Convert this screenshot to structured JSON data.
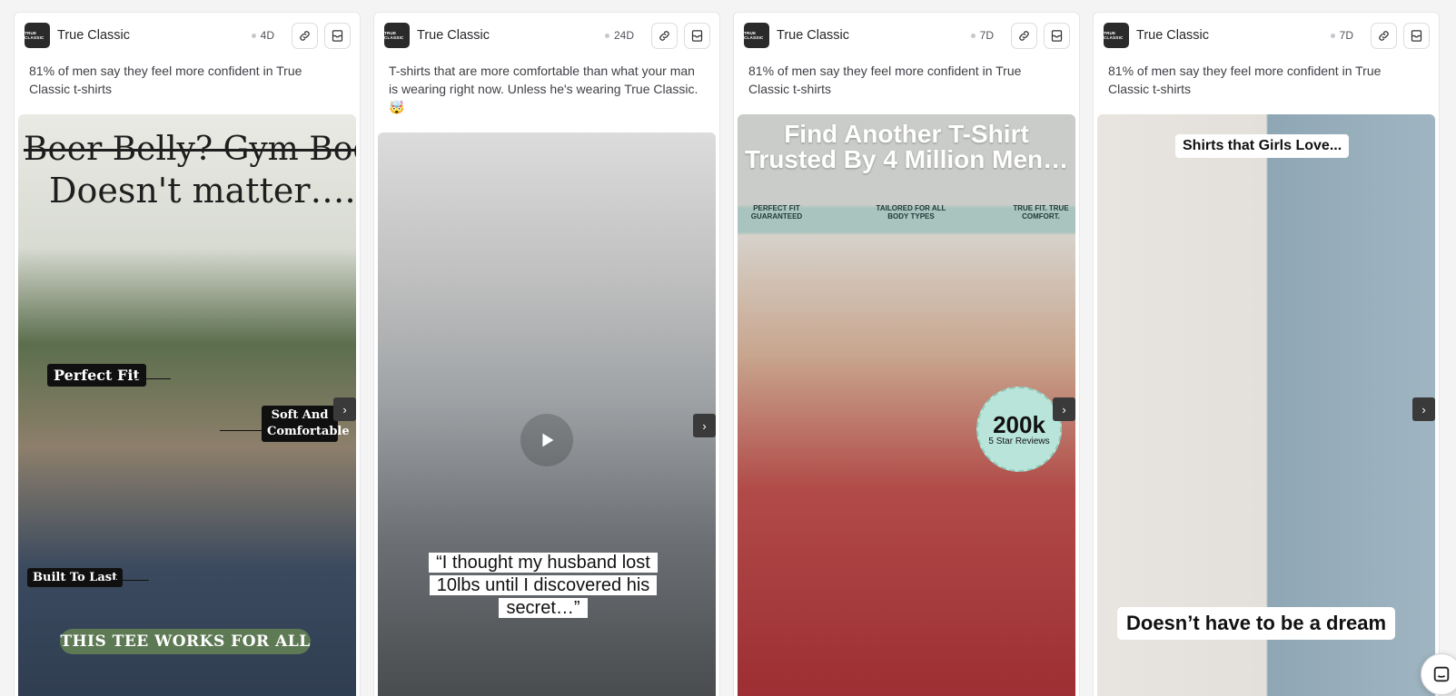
{
  "cards": [
    {
      "brand": "True Classic",
      "logo_text": "TRUE CLASSIC",
      "age": "4D",
      "caption": "81% of men say they feel more confident in True Classic t-shirts",
      "media": {
        "headline_struck": "Beer Belly? Gym Bod?",
        "headline": "Doesn't matter….",
        "tag_fit": "Perfect Fit",
        "tag_soft": "Soft And Comfortable",
        "tag_last": "Built To Last",
        "banner": "THIS TEE WORKS FOR ALL"
      }
    },
    {
      "brand": "True Classic",
      "logo_text": "TRUE CLASSIC",
      "age": "24D",
      "caption": "T-shirts that are more comfortable than what your man is wearing right now. Unless he's wearing True Classic. 🤯",
      "media": {
        "quote": "“I thought my husband lost 10lbs until I discovered his secret…”"
      }
    },
    {
      "brand": "True Classic",
      "logo_text": "TRUE CLASSIC",
      "age": "7D",
      "caption": "81% of men say they feel more confident in True Classic t-shirts",
      "media": {
        "headline": "Find Another T-Shirt Trusted By 4 Million Men…",
        "strip_1": "PERFECT FIT GUARANTEED",
        "strip_2": "TAILORED FOR ALL BODY TYPES",
        "strip_3": "TRUE FIT. TRUE COMFORT.",
        "badge_value": "200k",
        "badge_label": "5 Star Reviews"
      }
    },
    {
      "brand": "True Classic",
      "logo_text": "TRUE CLASSIC",
      "age": "7D",
      "caption": "81% of men say they feel more confident in True Classic t-shirts",
      "media": {
        "top_text": "Shirts that Girls Love...",
        "bottom_text": "Doesn’t have to be a dream"
      }
    }
  ],
  "icons": {
    "copy_link": "link-icon",
    "save": "bookmark-icon",
    "next": "chevron-right-icon",
    "play": "play-icon",
    "chat": "chat-icon"
  }
}
